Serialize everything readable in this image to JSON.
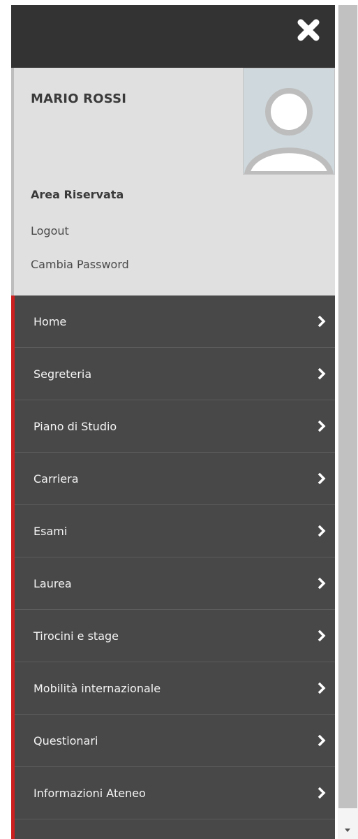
{
  "header": {
    "close_icon": "close-icon"
  },
  "user": {
    "name": "MARIO ROSSI",
    "avatar_icon": "user-avatar-icon",
    "area_title": "Area Riservata",
    "logout_label": "Logout",
    "change_password_label": "Cambia Password"
  },
  "menu": {
    "items": [
      {
        "label": "Home"
      },
      {
        "label": "Segreteria"
      },
      {
        "label": "Piano di Studio"
      },
      {
        "label": "Carriera"
      },
      {
        "label": "Esami"
      },
      {
        "label": "Laurea"
      },
      {
        "label": "Tirocini e stage"
      },
      {
        "label": "Mobilità internazionale"
      },
      {
        "label": "Questionari"
      },
      {
        "label": "Informazioni Ateneo"
      }
    ],
    "chevron_icon": "chevron-right-icon"
  },
  "colors": {
    "topbar": "#333333",
    "user_area": "#e0e0e0",
    "menu_bg": "#484848",
    "accent": "#cc1f1f"
  }
}
